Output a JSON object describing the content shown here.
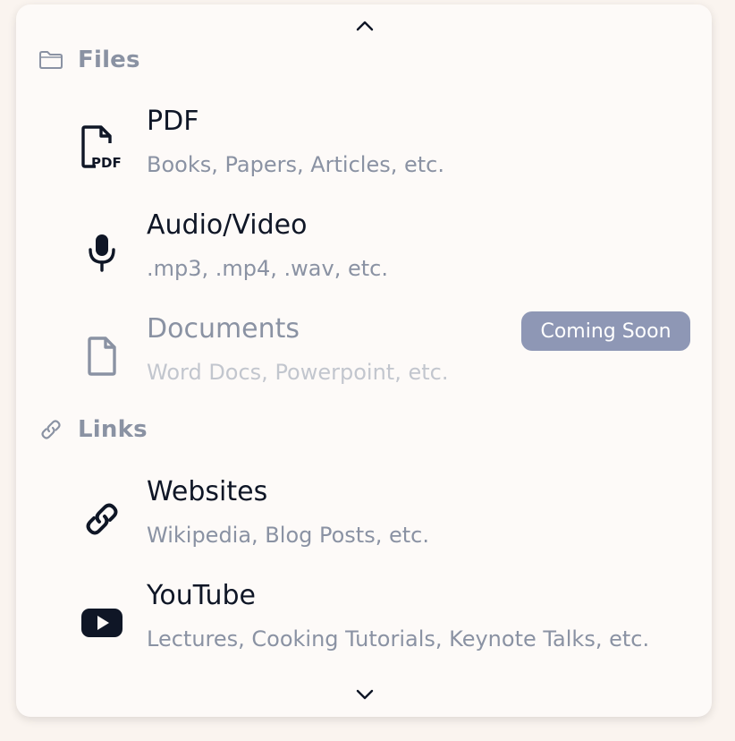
{
  "colors": {
    "page_background": "#faf4ef",
    "panel_background": "#fdfaf8",
    "title_text": "#0f1626",
    "muted_text": "#8a92a3",
    "disabled_desc_text": "#c2c6ce",
    "badge_background": "#8e97b5",
    "icon_dark": "#0f1626",
    "icon_muted": "#8a92a3"
  },
  "navigation": {
    "scroll_up_icon": "chevron-up-icon",
    "scroll_down_icon": "chevron-down-icon"
  },
  "sections": [
    {
      "label": "Files",
      "icon": "folder-icon",
      "items": [
        {
          "title": "PDF",
          "description": "Books, Papers, Articles, etc.",
          "icon": "pdf-file-icon",
          "disabled": false
        },
        {
          "title": "Audio/Video",
          "description": ".mp3, .mp4, .wav, etc.",
          "icon": "microphone-icon",
          "disabled": false
        },
        {
          "title": "Documents",
          "description": "Word Docs, Powerpoint, etc.",
          "icon": "document-icon",
          "disabled": true,
          "badge": "Coming Soon"
        }
      ]
    },
    {
      "label": "Links",
      "icon": "link-icon",
      "items": [
        {
          "title": "Websites",
          "description": "Wikipedia, Blog Posts, etc.",
          "icon": "link-icon",
          "disabled": false
        },
        {
          "title": "YouTube",
          "description": "Lectures, Cooking Tutorials, Keynote Talks, etc.",
          "icon": "youtube-icon",
          "disabled": false
        }
      ]
    }
  ]
}
